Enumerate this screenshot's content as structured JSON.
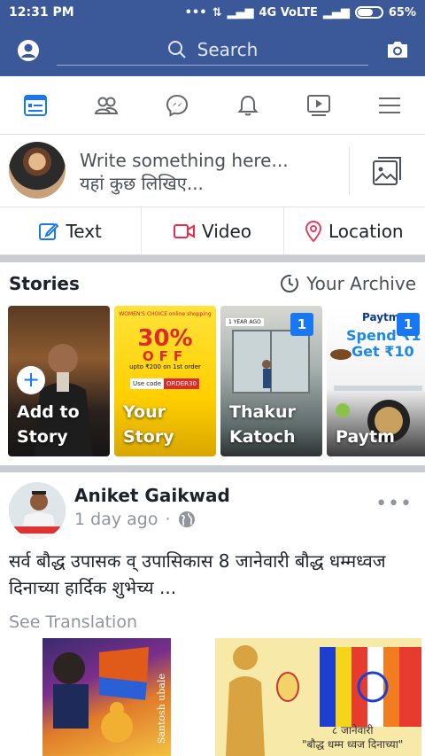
{
  "status_bar": {
    "time": "12:31 PM",
    "network": "4G VoLTE",
    "battery": "65%",
    "battery_level": 0.65
  },
  "top_bar": {
    "search_placeholder": "Search"
  },
  "nav_tabs": [
    {
      "icon": "news-feed-icon",
      "active": true
    },
    {
      "icon": "friends-icon"
    },
    {
      "icon": "messenger-icon"
    },
    {
      "icon": "notifications-icon"
    },
    {
      "icon": "watch-icon"
    },
    {
      "icon": "menu-icon"
    }
  ],
  "composer": {
    "prompt_en": "Write something here...",
    "prompt_hi": "यहां कुछ लिखिए..."
  },
  "actions": {
    "text": "Text",
    "video": "Video",
    "location": "Location"
  },
  "stories": {
    "title": "Stories",
    "archive": "Your Archive",
    "items": [
      {
        "label_line1": "Add to",
        "label_line2": "Story"
      },
      {
        "label_line1": "Your",
        "label_line2": "Story",
        "promo_heading": "WOMEN'S CHOICE online shopping",
        "promo_big": "30%",
        "promo_off": "OFF",
        "promo_upto": "upto ₹200 on 1st order",
        "promo_code_label": "Use code",
        "promo_code": "ORDER30"
      },
      {
        "label_line1": "Thakur",
        "label_line2": "Katoch",
        "count": "1",
        "tag": "1 YEAR AGO"
      },
      {
        "label_line1": "Paytm",
        "label_line2": "",
        "count": "1",
        "brand": "Paytm",
        "promo_line1": "Spend ₹1",
        "promo_line2": "Get ₹10"
      }
    ]
  },
  "post": {
    "author": "Aniket Gaikwad",
    "time": "1 day ago",
    "text": "सर्व बौद्ध उपासक व् उपासिकास 8 जानेवारी बौद्ध धम्मध्वज दिनाच्या हार्दिक शुभेच्य ...",
    "see_translation": "See Translation",
    "image1_signature": "Santosh ubale",
    "image2_caption_line1": "८ जानेवारी",
    "image2_caption_line2": "\"बौद्ध धम्म ध्वज दिनाच्या\""
  },
  "colors": {
    "brand_blue": "#3b5998",
    "accent_blue": "#1877f2",
    "video_red": "#f02849",
    "location_pink": "#e4405f"
  }
}
